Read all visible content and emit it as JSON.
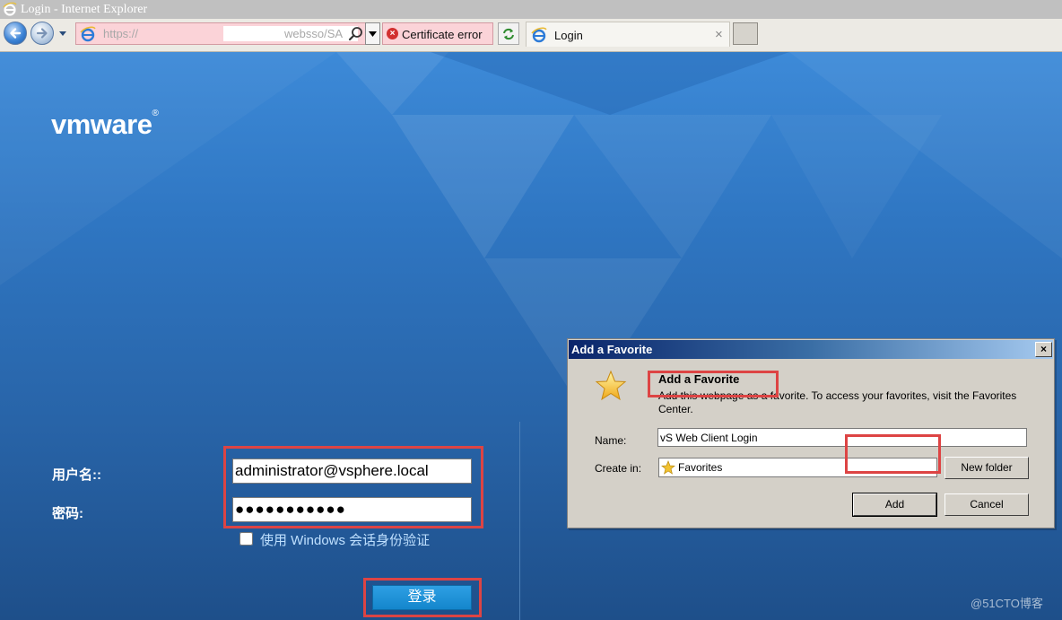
{
  "window": {
    "title": "Login - Internet Explorer"
  },
  "address_bar": {
    "url_start": "https://",
    "url_end": "websso/SA",
    "cert_error": "Certificate error"
  },
  "tab": {
    "label": "Login",
    "close": "×"
  },
  "page": {
    "logo": "vmware",
    "logo_mark": "®",
    "username_label": "用户名::",
    "password_label": "密码:",
    "username_value": "administrator@vsphere.local",
    "password_value": "●●●●●●●●●●●",
    "windows_session_label": "使用 Windows 会话身份验证",
    "windows_session_checked": false,
    "login_button": "登录",
    "watermark": "@51CTO博客"
  },
  "dialog": {
    "title": "Add a Favorite",
    "close": "×",
    "heading": "Add a Favorite",
    "description": "Add this webpage as a favorite. To access your favorites, visit the Favorites Center.",
    "name_label": "Name:",
    "name_value": "vS Web Client Login",
    "create_in_label": "Create in:",
    "create_in_value": "Favorites",
    "new_folder_button": "New folder",
    "add_button": "Add",
    "cancel_button": "Cancel"
  },
  "colors": {
    "highlight": "#dd4444",
    "page_blue": "#2f76c2",
    "login_button": "#1486cc",
    "dialog_title": "#0a246a"
  },
  "icons": [
    "ie-icon",
    "back-arrow-icon",
    "forward-arrow-icon",
    "search-icon",
    "cert-error-icon",
    "refresh-icon",
    "star-icon",
    "dropdown-arrow-icon"
  ]
}
